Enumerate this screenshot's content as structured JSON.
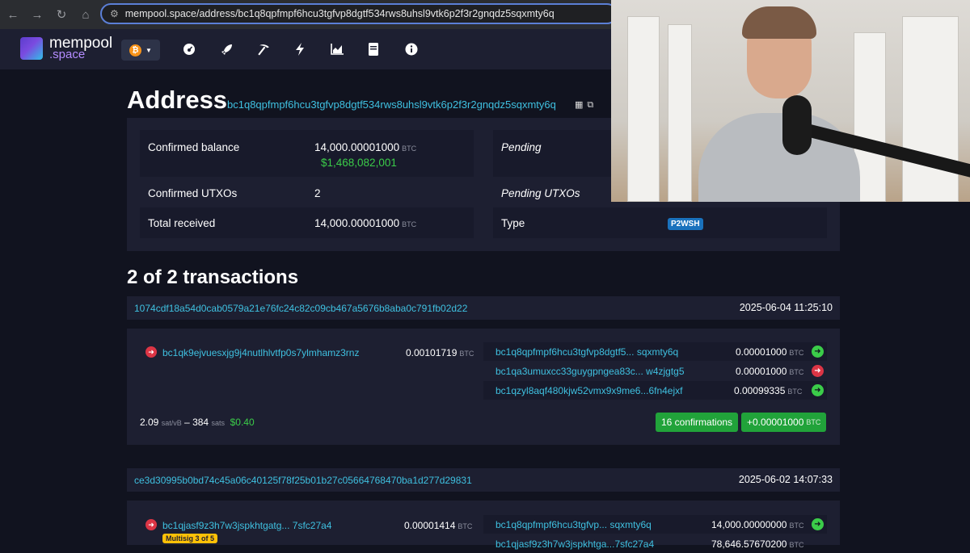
{
  "browser": {
    "url": "mempool.space/address/bc1q8qpfmpf6hcu3tgfvp8dgtf534rws8uhsl9vtk6p2f3r2gnqdz5sqxmty6q"
  },
  "header": {
    "logo_line1": "mempool",
    "logo_line2": ".space",
    "network_glyph": "₿",
    "nav_icons": [
      "dashboard-icon",
      "rocket-icon",
      "mining-icon",
      "lightning-icon",
      "graphs-icon",
      "docs-icon",
      "about-icon"
    ]
  },
  "address": {
    "title": "Address",
    "value": "bc1q8qpfmpf6hcu3tgfvp8dgtf534rws8uhsl9vtk6p2f3r2gnqdz5sqxmty6q"
  },
  "summary": {
    "confirmed_balance_label": "Confirmed balance",
    "confirmed_balance": "14,000.00001000",
    "confirmed_balance_usd": "$1,468,082,001",
    "pending_label": "Pending",
    "confirmed_utxos_label": "Confirmed UTXOs",
    "confirmed_utxos": "2",
    "pending_utxos_label": "Pending UTXOs",
    "total_received_label": "Total received",
    "total_received": "14,000.00001000",
    "type_label": "Type",
    "type": "P2WSH",
    "unit": "BTC"
  },
  "transactions_heading": "2 of 2 transactions",
  "transactions": [
    {
      "txid": "1074cdf18a54d0cab0579a21e76fc24c82c09cb467a5676b8aba0c791fb02d22",
      "time": "2025-06-04 11:25:10",
      "inputs": [
        {
          "address": "bc1qk9ejvuesxjg9j4nutlhlvtfp0s7ylmhamz3rnz",
          "amount": "0.00101719"
        }
      ],
      "outputs": [
        {
          "address": "bc1q8qpfmpf6hcu3tgfvp8dgtf5...",
          "address_end": "sqxmty6q",
          "amount": "0.00001000",
          "status": "unspent"
        },
        {
          "address": "bc1qa3umuxcc33guygpngea83c...",
          "address_end": "w4zjgtg5",
          "amount": "0.00001000",
          "status": "spent"
        },
        {
          "address": "bc1qzyl8aqf480kjw52vmx9x9me6...",
          "address_end": "6fn4ejxf",
          "amount": "0.00099335",
          "status": "unspent"
        }
      ],
      "fee_rate": "2.09",
      "fee_rate_unit": "sat/vB",
      "fee_sats": "384",
      "fee_sats_unit": "sats",
      "fee_usd": "$0.40",
      "confirmations": "16 confirmations",
      "net_amount": "+0.00001000"
    },
    {
      "txid": "ce3d30995b0bd74c45a06c40125f78f25b01b27c05664768470ba1d277d29831",
      "time": "2025-06-02 14:07:33",
      "inputs": [
        {
          "address": "bc1qjasf9z3h7w3jspkhtgatg...",
          "address_end": "7sfc27a4",
          "amount": "0.00001414",
          "badge": "Multisig 3 of 5"
        }
      ],
      "outputs": [
        {
          "address": "bc1q8qpfmpf6hcu3tgfvp...",
          "address_end": "sqxmty6q",
          "amount": "14,000.00000000",
          "status": "unspent"
        },
        {
          "address": "bc1qjasf9z3h7w3jspkhtga...",
          "address_end": "7sfc27a4",
          "amount": "78,646.57670200",
          "status": "unspent"
        }
      ]
    }
  ],
  "overlay": {
    "webcam": "presenter-webcam"
  }
}
